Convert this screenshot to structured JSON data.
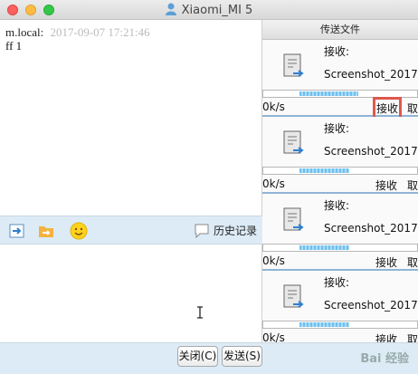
{
  "window": {
    "title": "Xiaomi_MI 5"
  },
  "chat": {
    "messages": [
      {
        "sender": "m.local:",
        "time": "2017-09-07 17:21:46",
        "text": "ff 1"
      }
    ]
  },
  "toolbar": {
    "history_label": "历史记录"
  },
  "buttons": {
    "close_label": "关闭(C)",
    "send_label": "发送(S)"
  },
  "watermark": "Bai 经验",
  "transfer_panel": {
    "title": "传送文件",
    "items": [
      {
        "label": "接收:",
        "filename": "Screenshot_2017",
        "speed": "0k/s",
        "receive": "接收",
        "cancel": "取",
        "progress": 0.61,
        "highlight": true
      },
      {
        "label": "接收:",
        "filename": "Screenshot_2017",
        "speed": "0k/s",
        "receive": "接收",
        "cancel": "取",
        "progress": 0.55,
        "highlight": false
      },
      {
        "label": "接收:",
        "filename": "Screenshot_2017",
        "speed": "0k/s",
        "receive": "接收",
        "cancel": "取",
        "progress": 0.55,
        "highlight": false
      },
      {
        "label": "接收:",
        "filename": "Screenshot_2017",
        "speed": "0k/s",
        "receive": "接收",
        "cancel": "取",
        "progress": 0.55,
        "highlight": false
      }
    ]
  },
  "colors": {
    "accent": "#dcebf6",
    "progress": "#6ec0f0",
    "highlight": "#e0584c"
  }
}
